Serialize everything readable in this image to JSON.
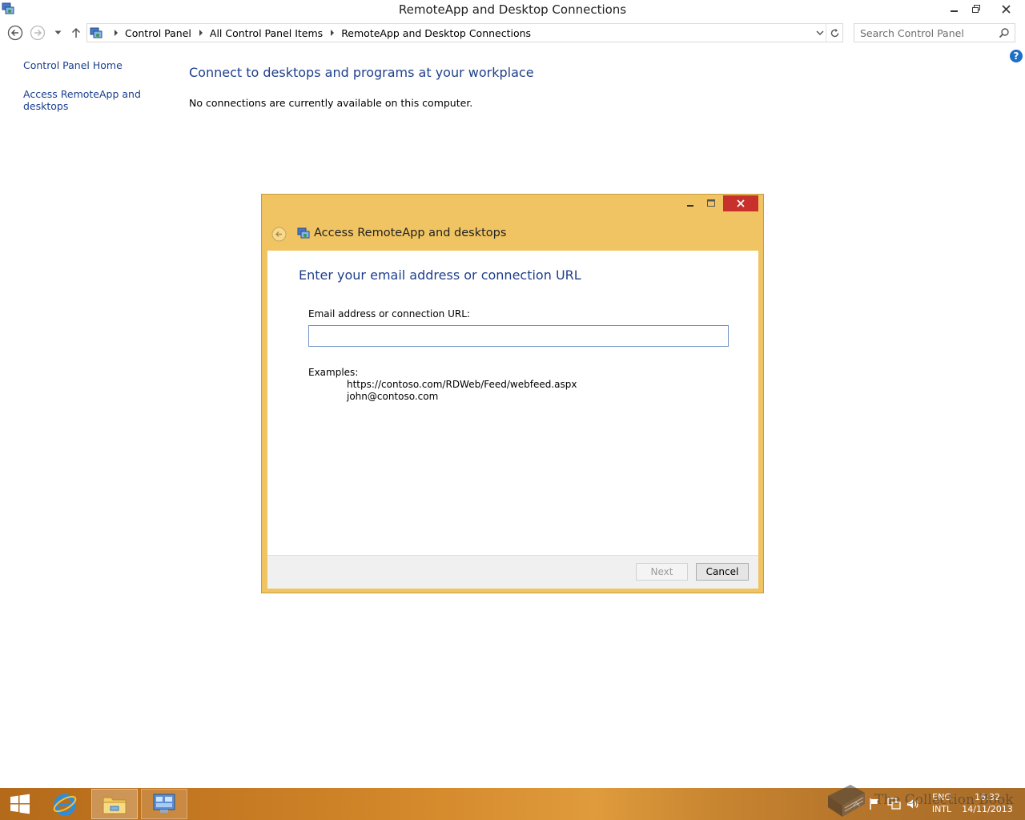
{
  "window": {
    "title": "RemoteApp and Desktop Connections"
  },
  "address_bar": {
    "breadcrumbs": [
      "Control Panel",
      "All Control Panel Items",
      "RemoteApp and Desktop Connections"
    ]
  },
  "search": {
    "placeholder": "Search Control Panel"
  },
  "left_pane": {
    "home_link": "Control Panel Home",
    "access_link": "Access RemoteApp and desktops"
  },
  "main": {
    "heading": "Connect to desktops and programs at your workplace",
    "message": "No connections are currently available on this computer."
  },
  "dialog": {
    "title": "Access RemoteApp and desktops",
    "heading": "Enter your email address or connection URL",
    "field_label": "Email address or connection URL:",
    "field_value": "",
    "examples_label": "Examples:",
    "examples": [
      "https://contoso.com/RDWeb/Feed/webfeed.aspx",
      "john@contoso.com"
    ],
    "next_label": "Next",
    "cancel_label": "Cancel"
  },
  "taskbar": {
    "language_top": "ENG",
    "language_bottom": "INTL",
    "time": "16:32",
    "date": "14/11/2013"
  },
  "watermark": {
    "text": "The Collection Book"
  },
  "colors": {
    "dialog_frame": "#f0c462",
    "link_blue": "#1a3e8f",
    "heading_blue": "#1e3f8c",
    "close_red": "#c7302b"
  }
}
